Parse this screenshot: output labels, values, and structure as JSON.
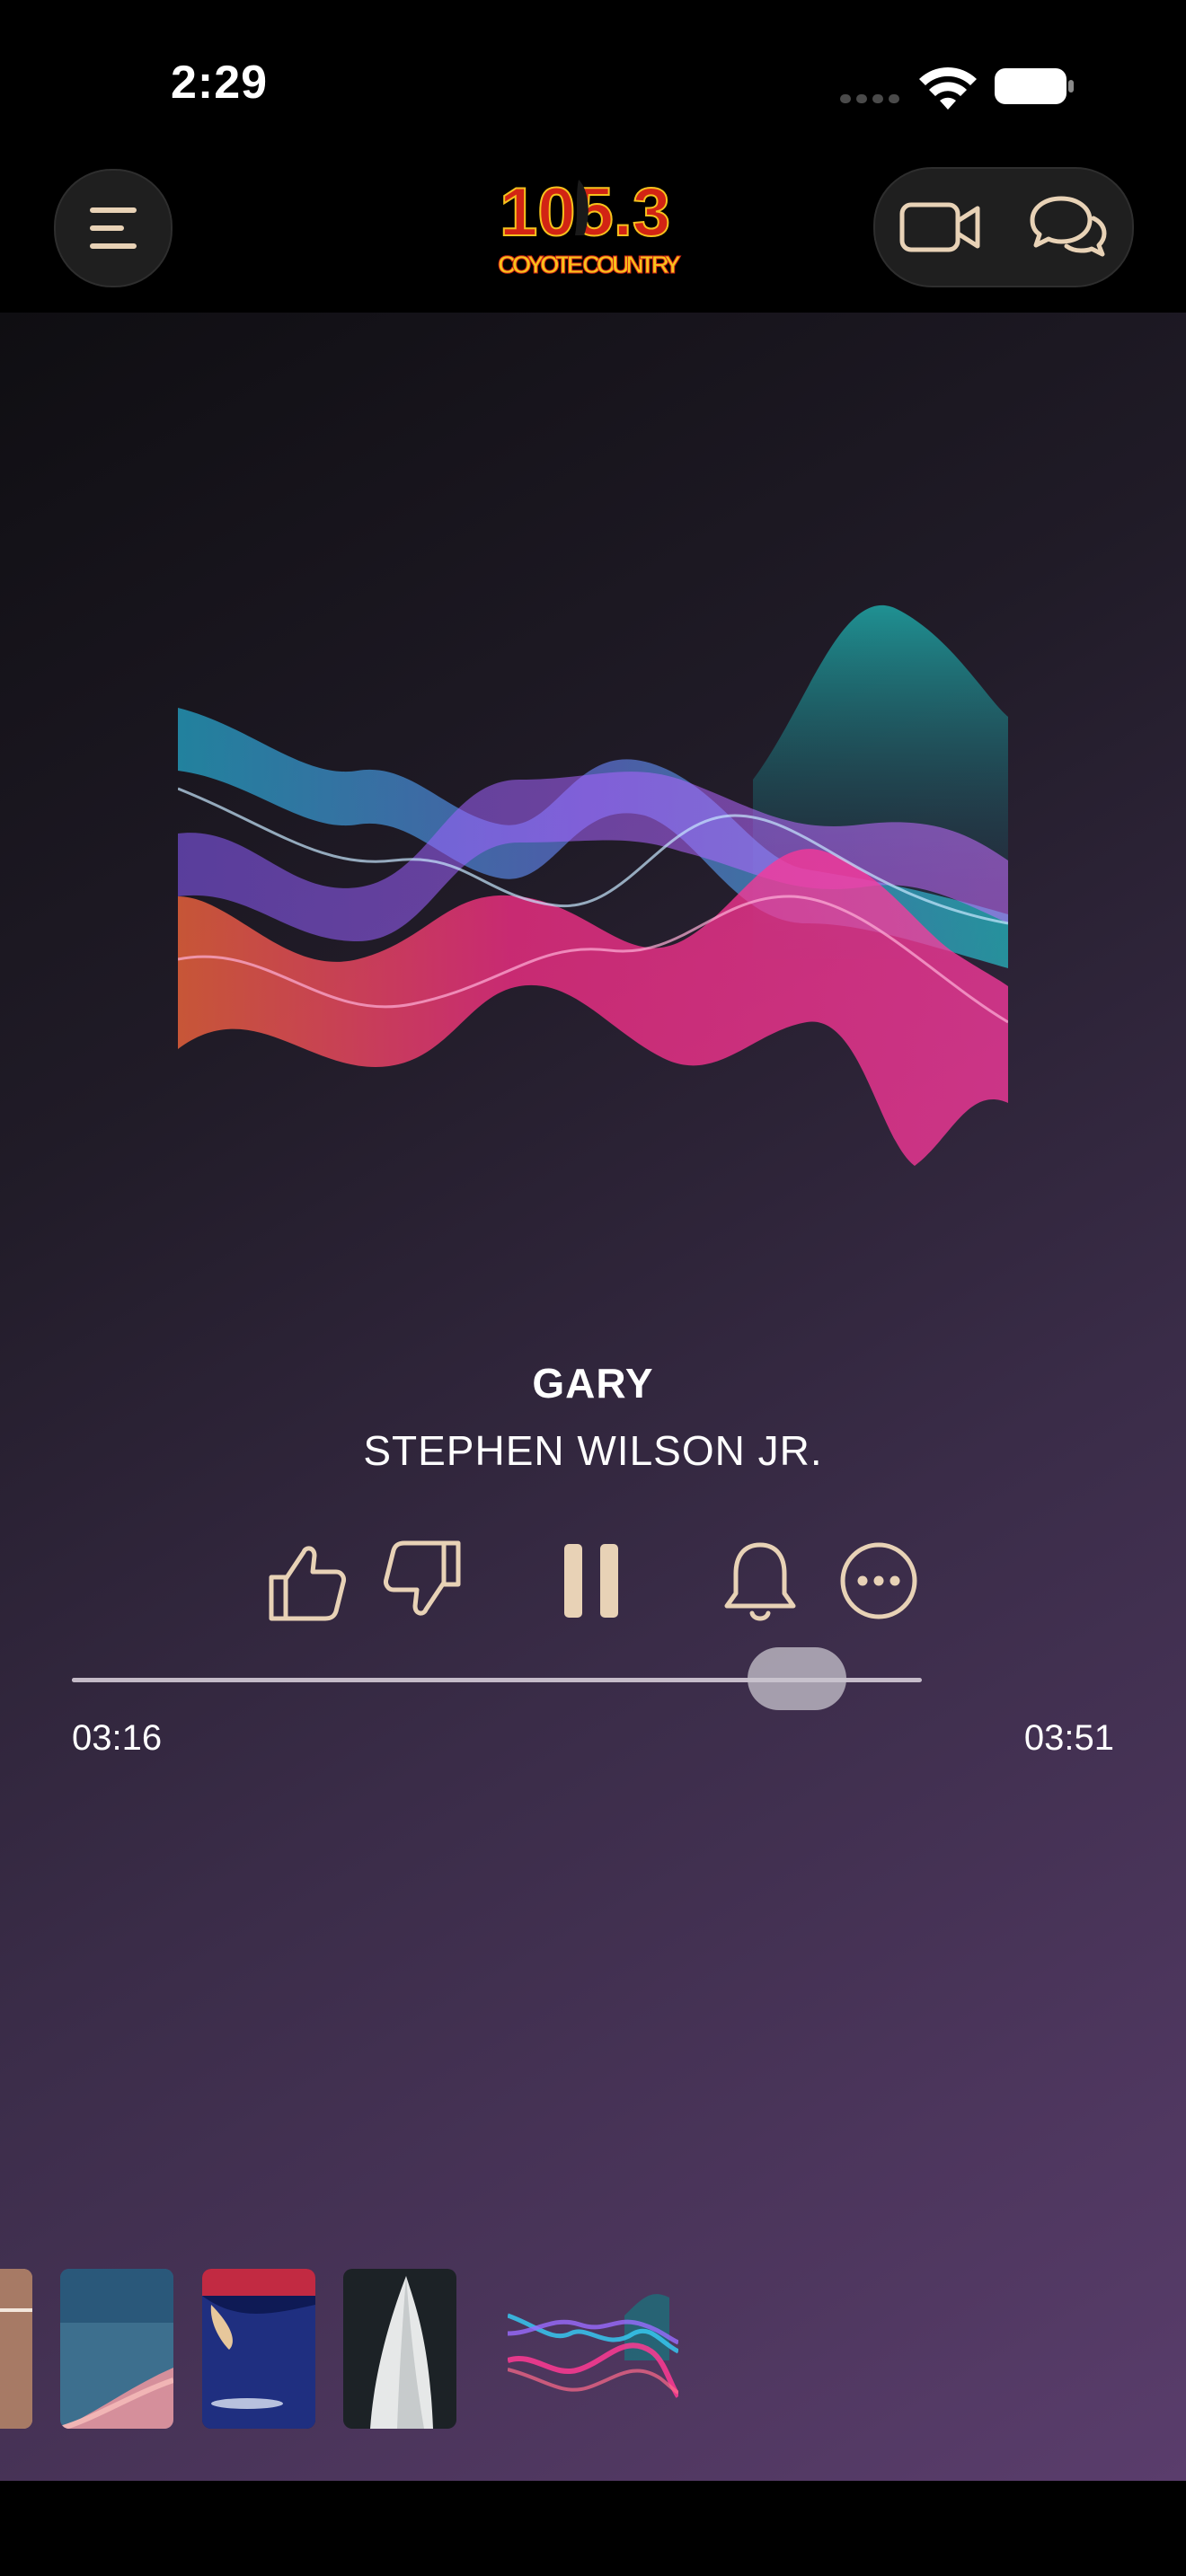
{
  "status_bar": {
    "time": "2:29"
  },
  "header": {
    "logo_text_top": "105.3",
    "logo_text_bottom": "COYOTE COUNTRY"
  },
  "now_playing": {
    "title": "GARY",
    "artist": "STEPHEN WILSON JR.",
    "elapsed": "03:16",
    "duration": "03:51",
    "progress": 0.853
  },
  "colors": {
    "accent": "#E8D2B6",
    "logo_red": "#D22414",
    "logo_yellow": "#F6C21C"
  },
  "icons": {
    "menu": "menu-icon",
    "video": "video-icon",
    "chat": "chat-icon",
    "thumb_up": "thumb-up-icon",
    "thumb_down": "thumb-down-icon",
    "pause": "pause-icon",
    "bell": "bell-icon",
    "more": "more-icon"
  }
}
